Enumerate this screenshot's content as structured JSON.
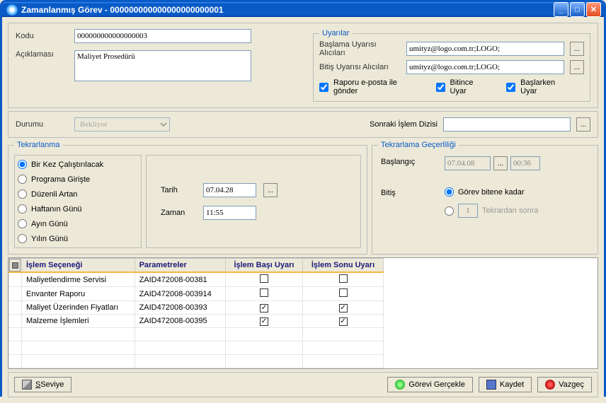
{
  "window": {
    "title": "Zamanlanmış Görev - 000000000000000000000001"
  },
  "fields": {
    "kodu_label": "Kodu",
    "kodu_value": "000000000000000003",
    "aciklamasi_label": "Açıklaması",
    "aciklamasi_value": "Maliyet Prosedürü",
    "durumu_label": "Durumu",
    "durumu_value": "Bekliyor",
    "sonraki_label": "Sonraki İşlem Dizisi",
    "sonraki_value": ""
  },
  "uyarilar": {
    "legend": "Uyarılar",
    "baslama_label": "Başlama Uyarısı Alıcıları",
    "baslama_value": "umityz@logo.com.tr;LOGO;",
    "bitis_label": "Bitiş Uyarısı Alıcıları",
    "bitis_value": "umityz@logo.com.tr;LOGO;",
    "eposta_label": "Raporu e-posta ile gönder",
    "bitince_label": "Bitince Uyar",
    "baslarken_label": "Başlarken Uyar"
  },
  "tekrarlanma": {
    "legend": "Tekrarlanma",
    "options": [
      "Bir Kez Çalıştırılacak",
      "Programa Girişte",
      "Düzenli Artan",
      "Haftanın Günü",
      "Ayın Günü",
      "Yılın Günü"
    ],
    "tarih_label": "Tarih",
    "tarih_value": "07.04.28",
    "zaman_label": "Zaman",
    "zaman_value": "11:55"
  },
  "gecerlilik": {
    "legend": "Tekrarlama Geçerliliği",
    "baslangic_label": "Başlangıç",
    "baslangic_date": "07.04.08",
    "baslangic_time": "00:36",
    "bitis_label": "Bitiş",
    "gorev_bitene": "Görev bitene kadar",
    "tekrar_count": "1",
    "tekrardan_sonra": "Tekrardan sonra"
  },
  "table": {
    "headers": [
      "İşlem Seçeneği",
      "Parametreler",
      "İşlem Başı Uyarı",
      "İşlem Sonu Uyarı"
    ],
    "rows": [
      {
        "secenek": "Maliyetlendirme Servisi",
        "param": "ZAID472008-00381",
        "basi": false,
        "sonu": false
      },
      {
        "secenek": "Envanter Raporu",
        "param": "ZAID472008-003914",
        "basi": false,
        "sonu": false
      },
      {
        "secenek": "Maliyet Üzerinden Fiyatları",
        "param": "ZAID472008-00393",
        "basi": true,
        "sonu": true
      },
      {
        "secenek": "Malzeme İşlemleri",
        "param": "ZAID472008-00395",
        "basi": true,
        "sonu": true
      }
    ]
  },
  "buttons": {
    "seviye": "Seviye",
    "gorevi": "Görevi Gerçekle",
    "kaydet": "Kaydet",
    "vazgec": "Vazgeç"
  }
}
